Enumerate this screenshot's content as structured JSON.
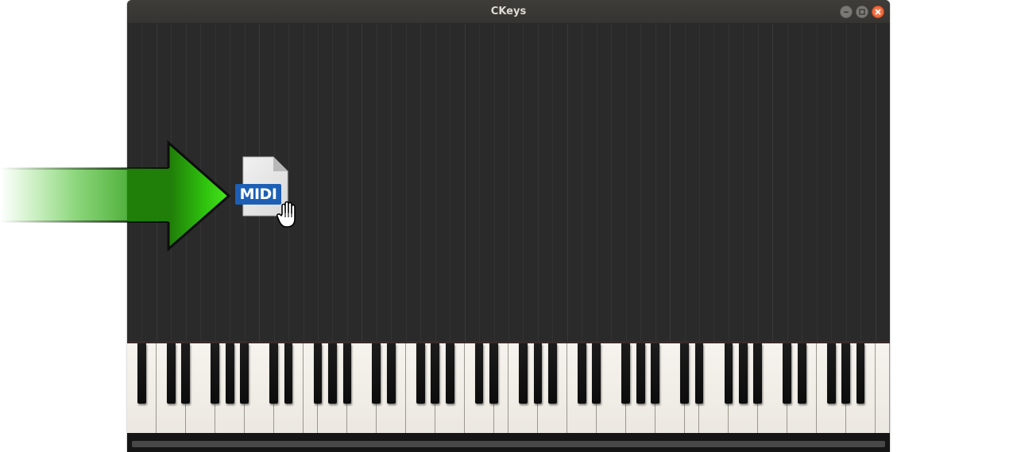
{
  "window": {
    "title": "CKeys",
    "controls": {
      "minimize": "minimize-icon",
      "maximize": "maximize-icon",
      "close": "close-icon"
    }
  },
  "drop_hint": {
    "arrow_icon": "arrow-right-icon",
    "file_icon": "midi-file-icon",
    "file_label": "MIDI",
    "cursor_icon": "grab-hand-cursor-icon"
  },
  "keyboard": {
    "white_key_count": 52
  },
  "colors": {
    "arrow_green": "#33cc11",
    "midi_blue": "#1d5fb5",
    "close_orange": "#e8562a",
    "roll_background": "#2a2a2a"
  }
}
